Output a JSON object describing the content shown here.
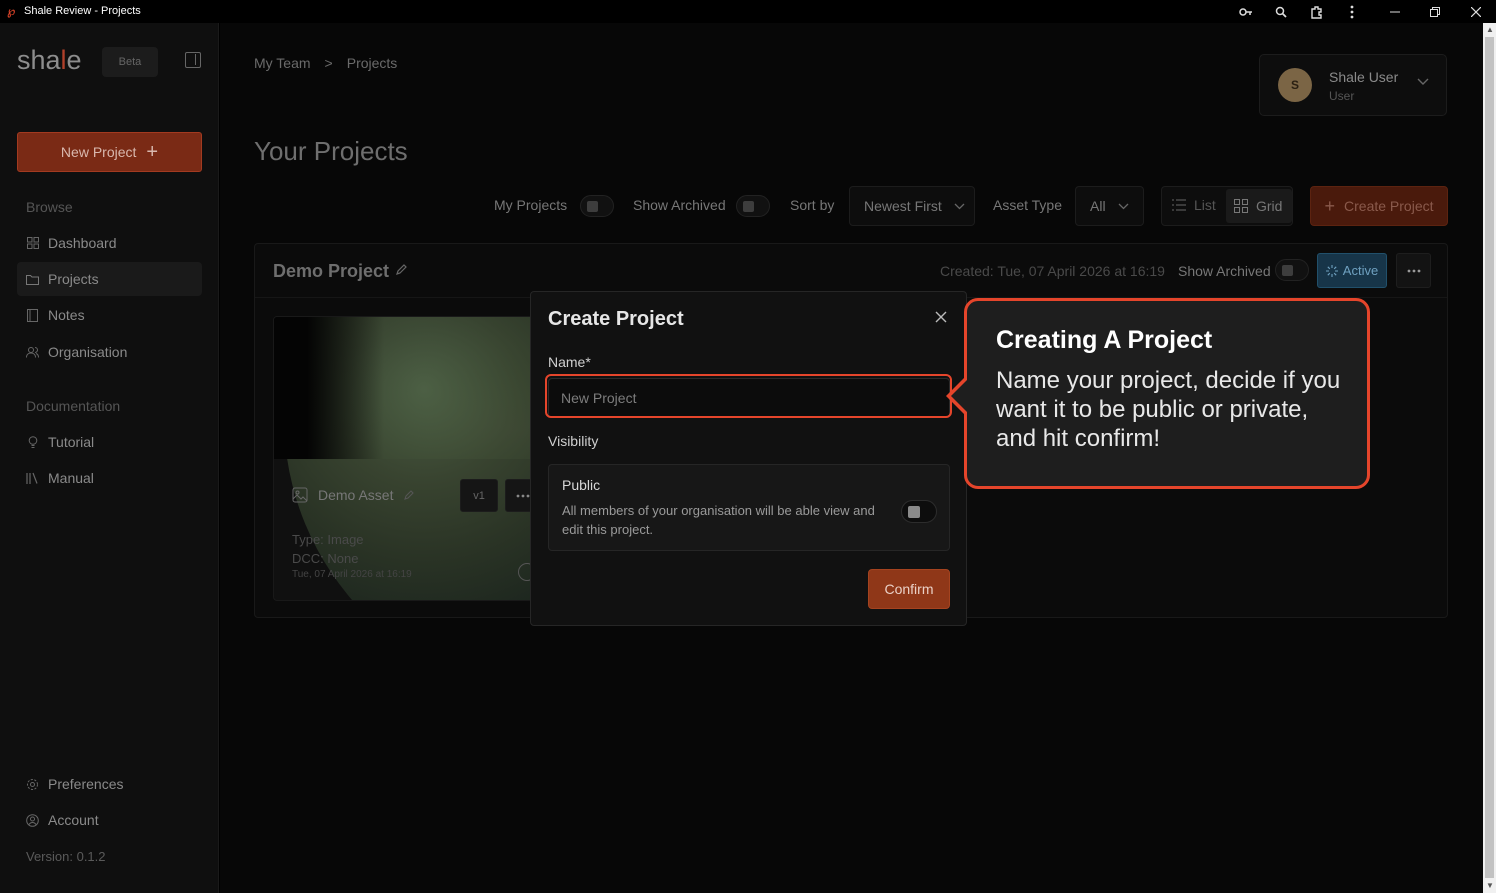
{
  "window": {
    "title": "Shale Review - Projects",
    "controls": [
      "key-icon",
      "zoom-icon",
      "extensions-icon",
      "kebab-menu-icon",
      "minimize-icon",
      "restore-icon",
      "close-icon"
    ]
  },
  "sidebar": {
    "logo": {
      "prefix": "sha",
      "mark": "l",
      "suffix": "e"
    },
    "beta_badge": "Beta",
    "new_project_label": "New Project",
    "browse_label": "Browse",
    "browse_items": [
      {
        "label": "Dashboard",
        "icon": "grid-icon",
        "active": false
      },
      {
        "label": "Projects",
        "icon": "folder-icon",
        "active": true
      },
      {
        "label": "Notes",
        "icon": "notebook-icon",
        "active": false
      },
      {
        "label": "Organisation",
        "icon": "users-icon",
        "active": false
      }
    ],
    "docs_label": "Documentation",
    "docs_items": [
      {
        "label": "Tutorial",
        "icon": "lightbulb-icon"
      },
      {
        "label": "Manual",
        "icon": "library-icon"
      }
    ],
    "bottom_items": [
      {
        "label": "Preferences",
        "icon": "gear-icon"
      },
      {
        "label": "Account",
        "icon": "user-circle-icon"
      }
    ],
    "version": "Version: 0.1.2"
  },
  "header": {
    "breadcrumb": [
      "My Team",
      "Projects"
    ],
    "user": {
      "initial": "S",
      "name": "Shale User",
      "role": "User"
    }
  },
  "page_title": "Your Projects",
  "filters": {
    "my_projects_label": "My Projects",
    "show_archived_label": "Show Archived",
    "sort_by_label": "Sort by",
    "sort_value": "Newest First",
    "asset_type_label": "Asset Type",
    "asset_type_value": "All",
    "view_list_label": "List",
    "view_grid_label": "Grid",
    "create_project_label": "Create Project"
  },
  "project": {
    "name": "Demo Project",
    "created": "Created: Tue, 07 April 2026 at 16:19",
    "show_archived_label": "Show Archived",
    "status": "Active",
    "asset": {
      "name": "Demo Asset",
      "version": "v1",
      "type": "Type: Image",
      "dcc": "DCC: None",
      "date": "Tue, 07 April 2026 at 16:19"
    }
  },
  "modal": {
    "title": "Create Project",
    "name_label": "Name*",
    "name_placeholder": "New Project",
    "visibility_label": "Visibility",
    "public_title": "Public",
    "public_desc": "All members of your organisation will be able view and edit this project.",
    "confirm_label": "Confirm"
  },
  "callout": {
    "title": "Creating A Project",
    "body": "Name your project, decide if you want it to be public or private, and hit confirm!"
  },
  "colors": {
    "accent": "#e5452b",
    "confirm": "#8f3718",
    "active": "#173549"
  }
}
